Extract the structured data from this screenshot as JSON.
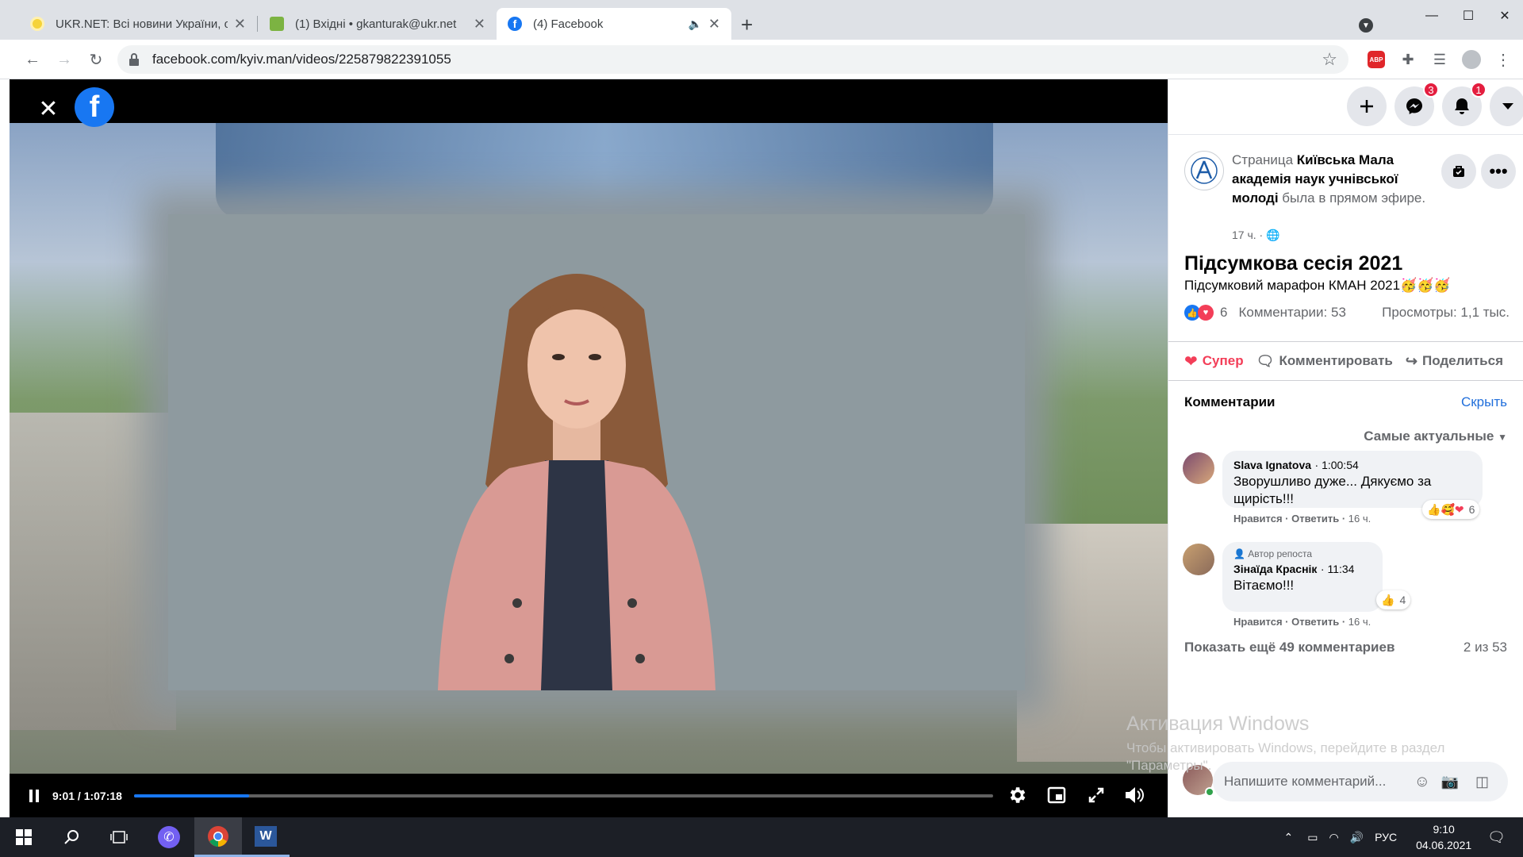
{
  "browser": {
    "tabs": [
      {
        "title": "UKR.NET: Всі новини України, ос",
        "icon": "ukrnet-favicon"
      },
      {
        "title": "(1) Вхідні • gkanturak@ukr.net",
        "icon": "mail-favicon"
      },
      {
        "title": "(4) Facebook",
        "icon": "facebook-favicon",
        "active": true
      }
    ],
    "new_tab": "+",
    "url": "facebook.com/kyiv.man/videos/225879822391055",
    "abp_label": "ABP"
  },
  "video": {
    "time": "9:01 / 1:07:18",
    "progress": 0.134
  },
  "header_buttons": {
    "messenger_badge": "3",
    "notifications_badge": "1"
  },
  "post": {
    "prefix": "Страница ",
    "page_name": "Київська Мала академія наук учнівської молоді",
    "suffix": " была в прямом эфире.",
    "time": "17 ч. · ",
    "title": "Підсумкова сесія 2021",
    "subtitle": "Підсумковий марафон КМАН 2021🥳🥳🥳",
    "reactions_count": "6",
    "comments_count": "Комментарии: 53",
    "views": "Просмотры: 1,1 тыс.",
    "actions": {
      "love": "Супер",
      "comment": "Комментировать",
      "share": "Поделиться"
    }
  },
  "comments": {
    "header": "Комментарии",
    "hide": "Скрыть",
    "sort": "Самые актуальные",
    "items": [
      {
        "author": "Slava Ignatova",
        "time": "1:00:54",
        "text": "Зворушливо дуже... Дякуємо за щирість!!!",
        "like": "Нравится",
        "reply": "Ответить",
        "age": "16 ч.",
        "reactions": "6"
      },
      {
        "badge": "Автор репоста",
        "author": "Зінаїда Краснік",
        "time": "11:34",
        "text": "Вітаємо!!!",
        "like": "Нравится",
        "reply": "Ответить",
        "age": "16 ч.",
        "reactions": "4"
      }
    ],
    "more": "Показать ещё 49 комментариев",
    "count": "2 из 53",
    "write_placeholder": "Напишите комментарий..."
  },
  "watermark": {
    "line1": "Активация Windows",
    "line2": "Чтобы активировать Windows, перейдите в раздел",
    "line3": "\"Параметры\"."
  },
  "taskbar": {
    "lang": "РУС",
    "time": "9:10",
    "date": "04.06.2021"
  },
  "colors": {
    "fb_blue": "#1877f2",
    "love_red": "#f33e58",
    "badge_red": "#e41e3f"
  }
}
